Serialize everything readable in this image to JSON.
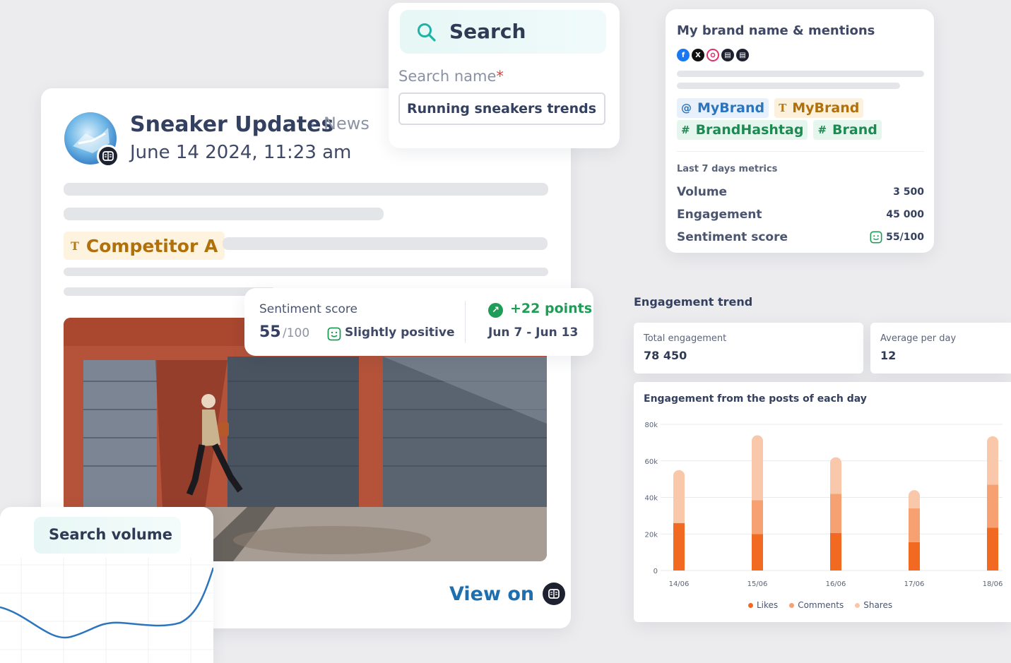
{
  "post": {
    "author": "Sneaker Updates",
    "separator": "·",
    "type": "News",
    "date": "June 14 2024, 11:23 am",
    "competitor_tag": "Competitor A",
    "view_on_label": "View on"
  },
  "sentiment": {
    "label": "Sentiment score",
    "score": "55",
    "max": "/100",
    "text": "Slightly positive",
    "change": "+22 points",
    "range": "Jun 7 - Jun 13"
  },
  "search": {
    "title": "Search",
    "name_label": "Search name",
    "required_mark": "*",
    "input_value": "Running sneakers trends"
  },
  "brand": {
    "title": "My brand name & mentions",
    "social_icons": [
      "facebook-icon",
      "x-icon",
      "instagram-icon",
      "source-icon",
      "source-icon"
    ],
    "keywords_row1": [
      {
        "icon": "@",
        "label": "MyBrand"
      },
      {
        "icon": "T",
        "label": "MyBrand"
      }
    ],
    "keywords_row2": [
      {
        "icon": "#",
        "label": "BrandHashtag"
      },
      {
        "icon": "#",
        "label": "Brand"
      }
    ],
    "metrics_label": "Last 7 days metrics",
    "metrics": [
      {
        "name": "Volume",
        "value": "3 500"
      },
      {
        "name": "Engagement",
        "value": "45 000"
      },
      {
        "name": "Sentiment score",
        "value": "55/100"
      }
    ]
  },
  "engagement": {
    "heading": "Engagement trend",
    "total_label": "Total engagement",
    "total_value": "78 450",
    "avg_label": "Average per day",
    "avg_value": "12"
  },
  "chart_data": {
    "type": "bar",
    "stacked": true,
    "title": "Engagement from the posts of each day",
    "categories": [
      "14/06",
      "15/06",
      "16/06",
      "17/06",
      "18/06"
    ],
    "series": [
      {
        "name": "Likes",
        "values": [
          26000,
          20000,
          20500,
          15500,
          23500
        ],
        "color": "#f26a21"
      },
      {
        "name": "Comments",
        "values": [
          0,
          18500,
          21500,
          18500,
          23500
        ],
        "color": "#f7a173"
      },
      {
        "name": "Shares",
        "values": [
          29000,
          35500,
          20000,
          10000,
          26500
        ],
        "color": "#f9c7aa"
      }
    ],
    "yticks": [
      "80k",
      "60k",
      "40k",
      "20k",
      "0"
    ],
    "ylim": [
      0,
      80000
    ],
    "grid": true,
    "legend": "bottom"
  },
  "volume": {
    "title": "Search volume",
    "line_color": "#2b75be"
  },
  "colors": {
    "accent_green": "#1f9d57",
    "accent_blue": "#1d6fb0",
    "accent_gold": "#b0700c"
  }
}
